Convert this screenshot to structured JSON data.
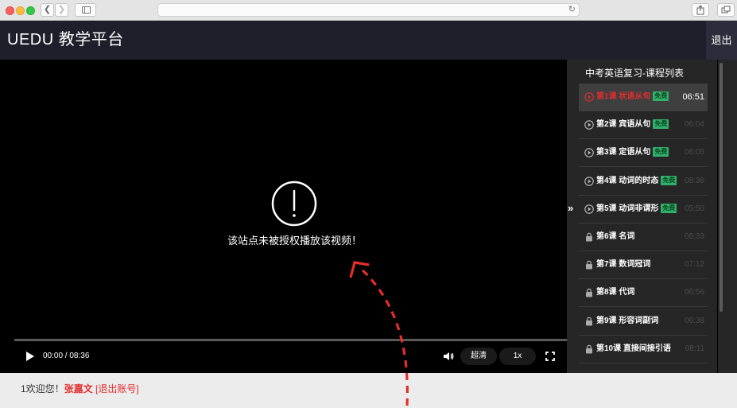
{
  "colors": {
    "header_bg": "#1f1f2c",
    "accent_red": "#e42d2d",
    "free_badge": "#31b06b",
    "playlist_bg": "#262626"
  },
  "site": {
    "title": "UEDU 教学平台",
    "logout_label": "退出"
  },
  "player": {
    "error_icon": "exclamation-circle-icon",
    "error_message": "该站点未被授权播放该视频！",
    "time_display": "00:00 / 08:36",
    "quality_label": "超清",
    "speed_label": "1x"
  },
  "playlist": {
    "title": "中考英语复习-课程列表",
    "collapse_symbol": "»",
    "free_badge_label": "免费",
    "lessons": [
      {
        "name": "第1课 状语从句",
        "duration": "06:51",
        "free": true,
        "locked": false,
        "active": true
      },
      {
        "name": "第2课 宾语从句",
        "duration": "06:04",
        "free": true,
        "locked": false,
        "active": false
      },
      {
        "name": "第3课 定语从句",
        "duration": "06:05",
        "free": true,
        "locked": false,
        "active": false
      },
      {
        "name": "第4课 动词的时态",
        "duration": "08:36",
        "free": true,
        "locked": false,
        "active": false
      },
      {
        "name": "第5课 动词非谓形",
        "duration": "05:50",
        "free": true,
        "locked": false,
        "active": false
      },
      {
        "name": "第6课 名词",
        "duration": "06:33",
        "free": false,
        "locked": true,
        "active": false
      },
      {
        "name": "第7课 数词冠词",
        "duration": "07:12",
        "free": false,
        "locked": true,
        "active": false
      },
      {
        "name": "第8课 代词",
        "duration": "06:56",
        "free": false,
        "locked": true,
        "active": false
      },
      {
        "name": "第9课 形容词副词",
        "duration": "06:38",
        "free": false,
        "locked": true,
        "active": false
      },
      {
        "name": "第10课 直接间接引语",
        "duration": "08:11",
        "free": false,
        "locked": true,
        "active": false
      }
    ]
  },
  "footer": {
    "welcome_prefix": "1欢迎您！",
    "username": "张嘉文",
    "logout_link": "[退出账号]"
  }
}
